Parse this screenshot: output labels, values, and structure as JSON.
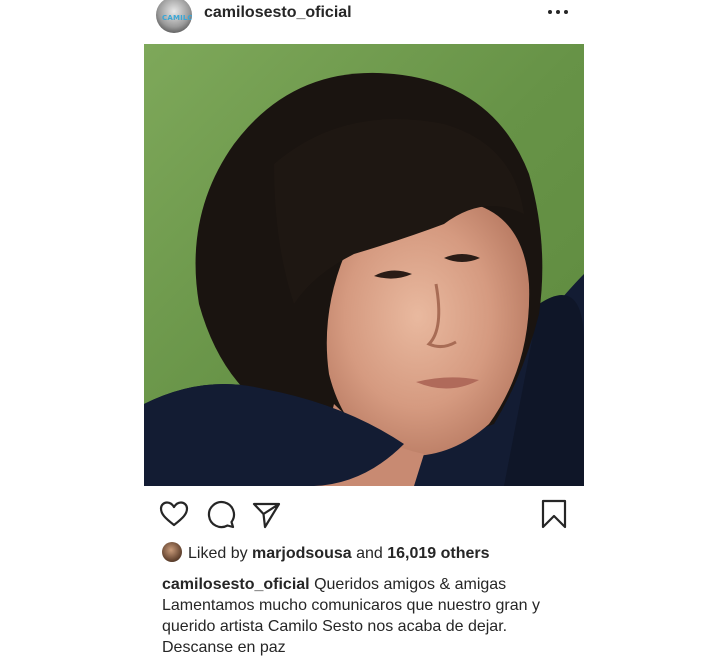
{
  "post": {
    "username": "camilosesto_oficial",
    "avatar_tag": "CAMILO",
    "more_icon": "more-horizontal-icon",
    "photo_alt": "profile photo of a man with dark hair"
  },
  "actions": {
    "like_icon": "heart-icon",
    "comment_icon": "comment-icon",
    "share_icon": "send-icon",
    "save_icon": "bookmark-icon"
  },
  "likes": {
    "prefix": "Liked by",
    "user": "marjodsousa",
    "conjunction": "and",
    "others": "16,019 others"
  },
  "caption": {
    "username": "camilosesto_oficial",
    "line1": "Queridos amigos & amigas",
    "line2": "Lamentamos mucho comunicaros que nuestro gran y",
    "line3": "querido artista Camilo Sesto nos acaba de dejar.",
    "line4": "Descanse en paz"
  },
  "colors": {
    "text": "#262626",
    "grass": "#6f9a4a",
    "hair": "#1a1410"
  }
}
